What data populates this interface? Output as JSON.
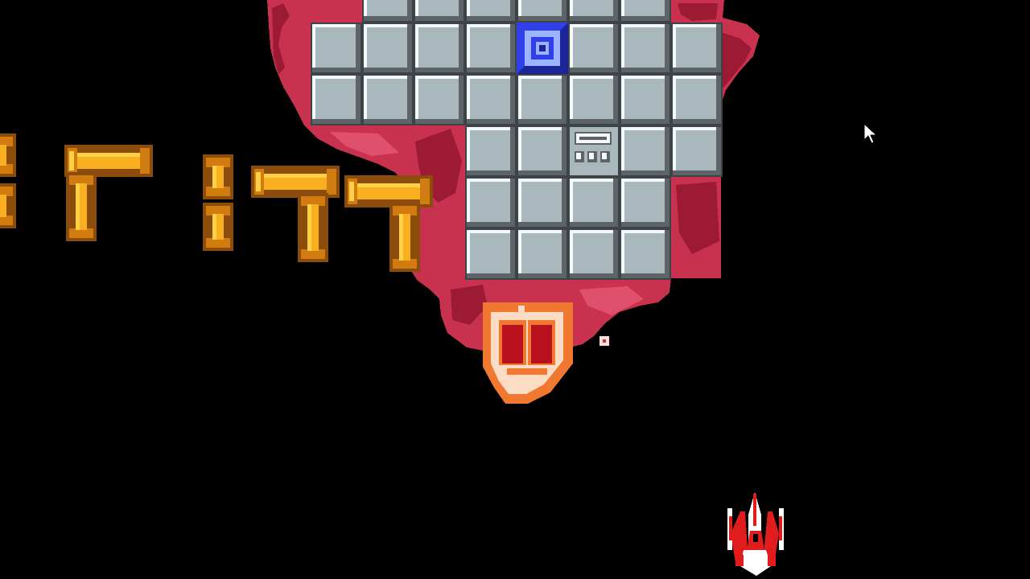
{
  "game": {
    "title": "",
    "background": "#000000"
  },
  "colors": {
    "space": "#000000",
    "terrain": "#c8324e",
    "terrain_dark": "#9c1a34",
    "terrain_light": "#e0506c",
    "tile_face": "#a8b8bc",
    "tile_highlight": "#f4f8f8",
    "tile_shadow": "#5c6468",
    "tile_edge": "#3c4448",
    "core_blue": "#3040e8",
    "core_blue_light": "#9cb4ff",
    "core_blue_dark": "#1c2498",
    "enemy_gold": "#f8b020",
    "enemy_gold_light": "#ffd048",
    "enemy_gold_dark": "#8c4c0c",
    "enemy_gold_mid": "#d07c10",
    "shield_orange": "#f07830",
    "shield_cream": "#fcdcc4",
    "shield_red": "#b8101c",
    "player_red": "#e01c1c",
    "player_white": "#ffffff",
    "bullet": "#fcdcd4"
  },
  "icons": {
    "cursor": "mouse-pointer-icon",
    "player": "fighter-ship-icon",
    "core": "ground-core-target-icon",
    "panel": "ground-panel-icon",
    "shield": "shield-enemy-icon",
    "formation": "gold-cross-enemy-icon",
    "bullet": "enemy-bullet-icon"
  }
}
